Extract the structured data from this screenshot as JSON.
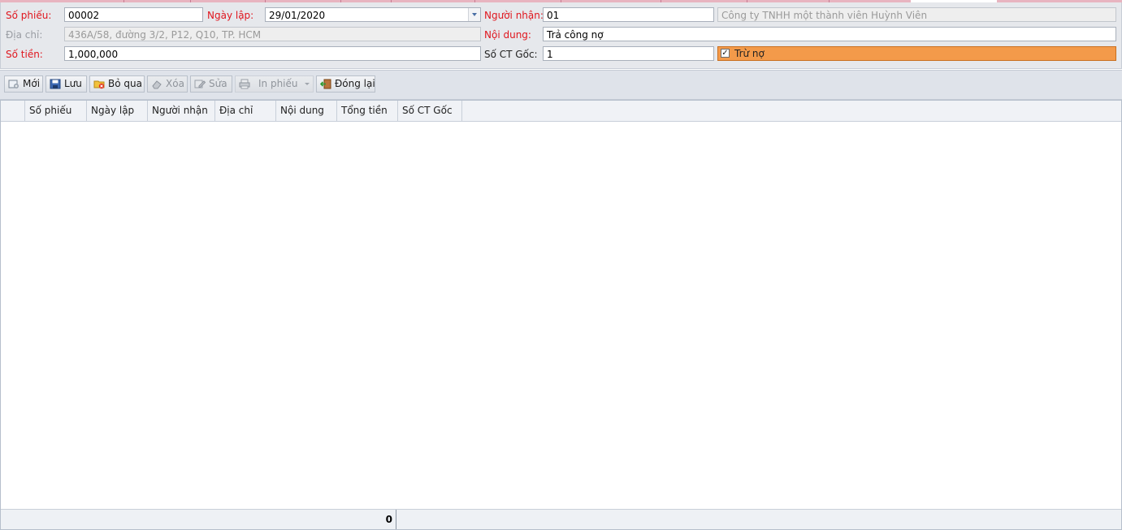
{
  "form": {
    "so_phieu": {
      "label": "Số phiếu:",
      "value": "00002"
    },
    "ngay_lap": {
      "label": "Ngày lập:",
      "value": "29/01/2020"
    },
    "nguoi_nhan": {
      "label": "Người nhận:",
      "code": "01",
      "name": "Công ty TNHH một thành viên Huỳnh Viên"
    },
    "dia_chi": {
      "label": "Địa chỉ:",
      "value": "436A/58, đường 3/2, P12, Q10, TP. HCM"
    },
    "noi_dung": {
      "label": "Nội dung:",
      "value": "Trả công nợ"
    },
    "so_tien": {
      "label": "Số tiền:",
      "value": "1,000,000"
    },
    "so_ct_goc": {
      "label": "Số CT Gốc:",
      "value": "1"
    },
    "tru_no": {
      "label": "Trừ nợ",
      "checked": "✓"
    }
  },
  "toolbar": {
    "moi": "Mới",
    "luu": "Lưu",
    "bo_qua": "Bỏ qua",
    "xoa": "Xóa",
    "sua": "Sửa",
    "in_phieu": "In phiếu",
    "dong_lai": "Đóng lại"
  },
  "grid": {
    "columns": [
      "Số phiếu",
      "Ngày lập",
      "Người nhận",
      "Địa chỉ",
      "Nội dung",
      "Tổng tiền",
      "Số CT Gốc"
    ],
    "total": "0"
  },
  "colors": {
    "label_red": "#e0161e",
    "checkbox_bg": "#f39a4a",
    "form_bg": "#e6e8ec"
  }
}
